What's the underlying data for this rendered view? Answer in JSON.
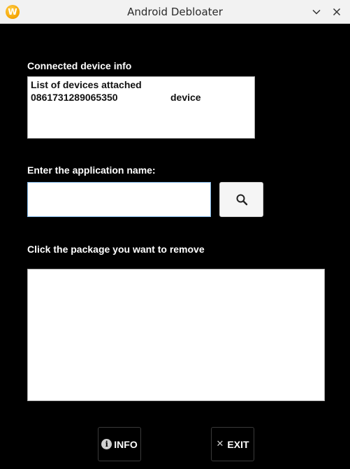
{
  "window": {
    "title": "Android Debloater",
    "app_icon_letter": "W",
    "app_icon": "app-logo-icon",
    "minimize_icon": "chevron-down-icon",
    "close_icon": "close-icon"
  },
  "device_section": {
    "label": "Connected device info",
    "header_line": "List of devices attached",
    "devices": [
      {
        "serial": "0861731289065350",
        "state": "device"
      }
    ]
  },
  "search_section": {
    "label": "Enter the application name:",
    "input_value": "",
    "search_icon": "search-icon"
  },
  "package_section": {
    "label": "Click the package you want to remove",
    "packages": []
  },
  "buttons": {
    "info_label": "INFO",
    "info_icon": "info-icon",
    "exit_label": "EXIT",
    "exit_icon": "close-icon"
  },
  "colors": {
    "background": "#000000",
    "titlebar": "#f2f2f2",
    "input_focus_border": "#7fb6e6",
    "app_icon": "#f5a300"
  }
}
